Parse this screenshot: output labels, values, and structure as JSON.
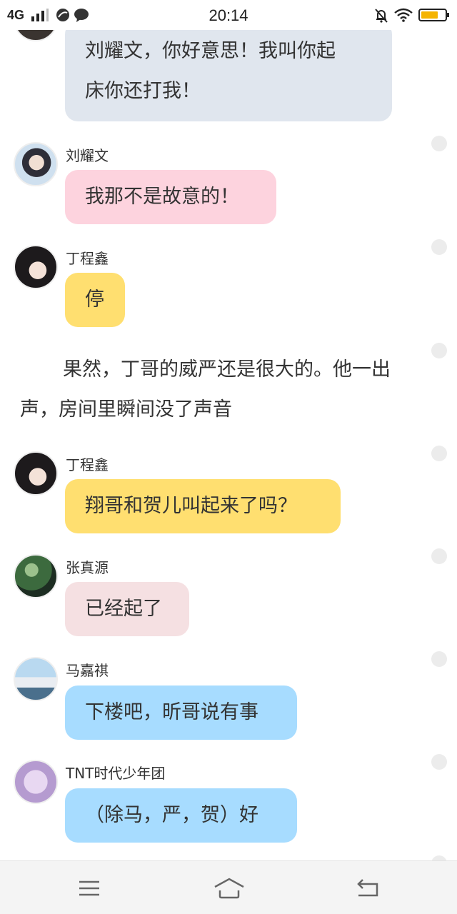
{
  "status_bar": {
    "network": "4G",
    "time": "20:14",
    "battery_color": "#f5b400"
  },
  "messages": [
    {
      "type": "bubble",
      "text_line1": "刘耀文，你好意思！我叫你起",
      "text_line2": "床你还打我！",
      "color": "#e0e6ee"
    },
    {
      "type": "message",
      "sender": "刘耀文",
      "text": "我那不是故意的！",
      "color": "#fdd3de"
    },
    {
      "type": "message",
      "sender": "丁程鑫",
      "text": "停",
      "color": "#ffdf70"
    },
    {
      "type": "narration",
      "text": "果然，丁哥的威严还是很大的。他一出声，房间里瞬间没了声音"
    },
    {
      "type": "message",
      "sender": "丁程鑫",
      "text": "翔哥和贺儿叫起来了吗？",
      "color": "#ffdf70"
    },
    {
      "type": "message",
      "sender": "张真源",
      "text": "已经起了",
      "color": "#f5e0e2"
    },
    {
      "type": "message",
      "sender": "马嘉祺",
      "text": "下楼吧，昕哥说有事",
      "color": "#a7dcff"
    },
    {
      "type": "message",
      "sender": "TNT时代少年团",
      "text": "（除马，严，贺）好",
      "color": "#a7dcff"
    }
  ],
  "nav": {
    "menu_icon": "menu-icon",
    "home_icon": "home-icon",
    "back_icon": "back-icon"
  }
}
